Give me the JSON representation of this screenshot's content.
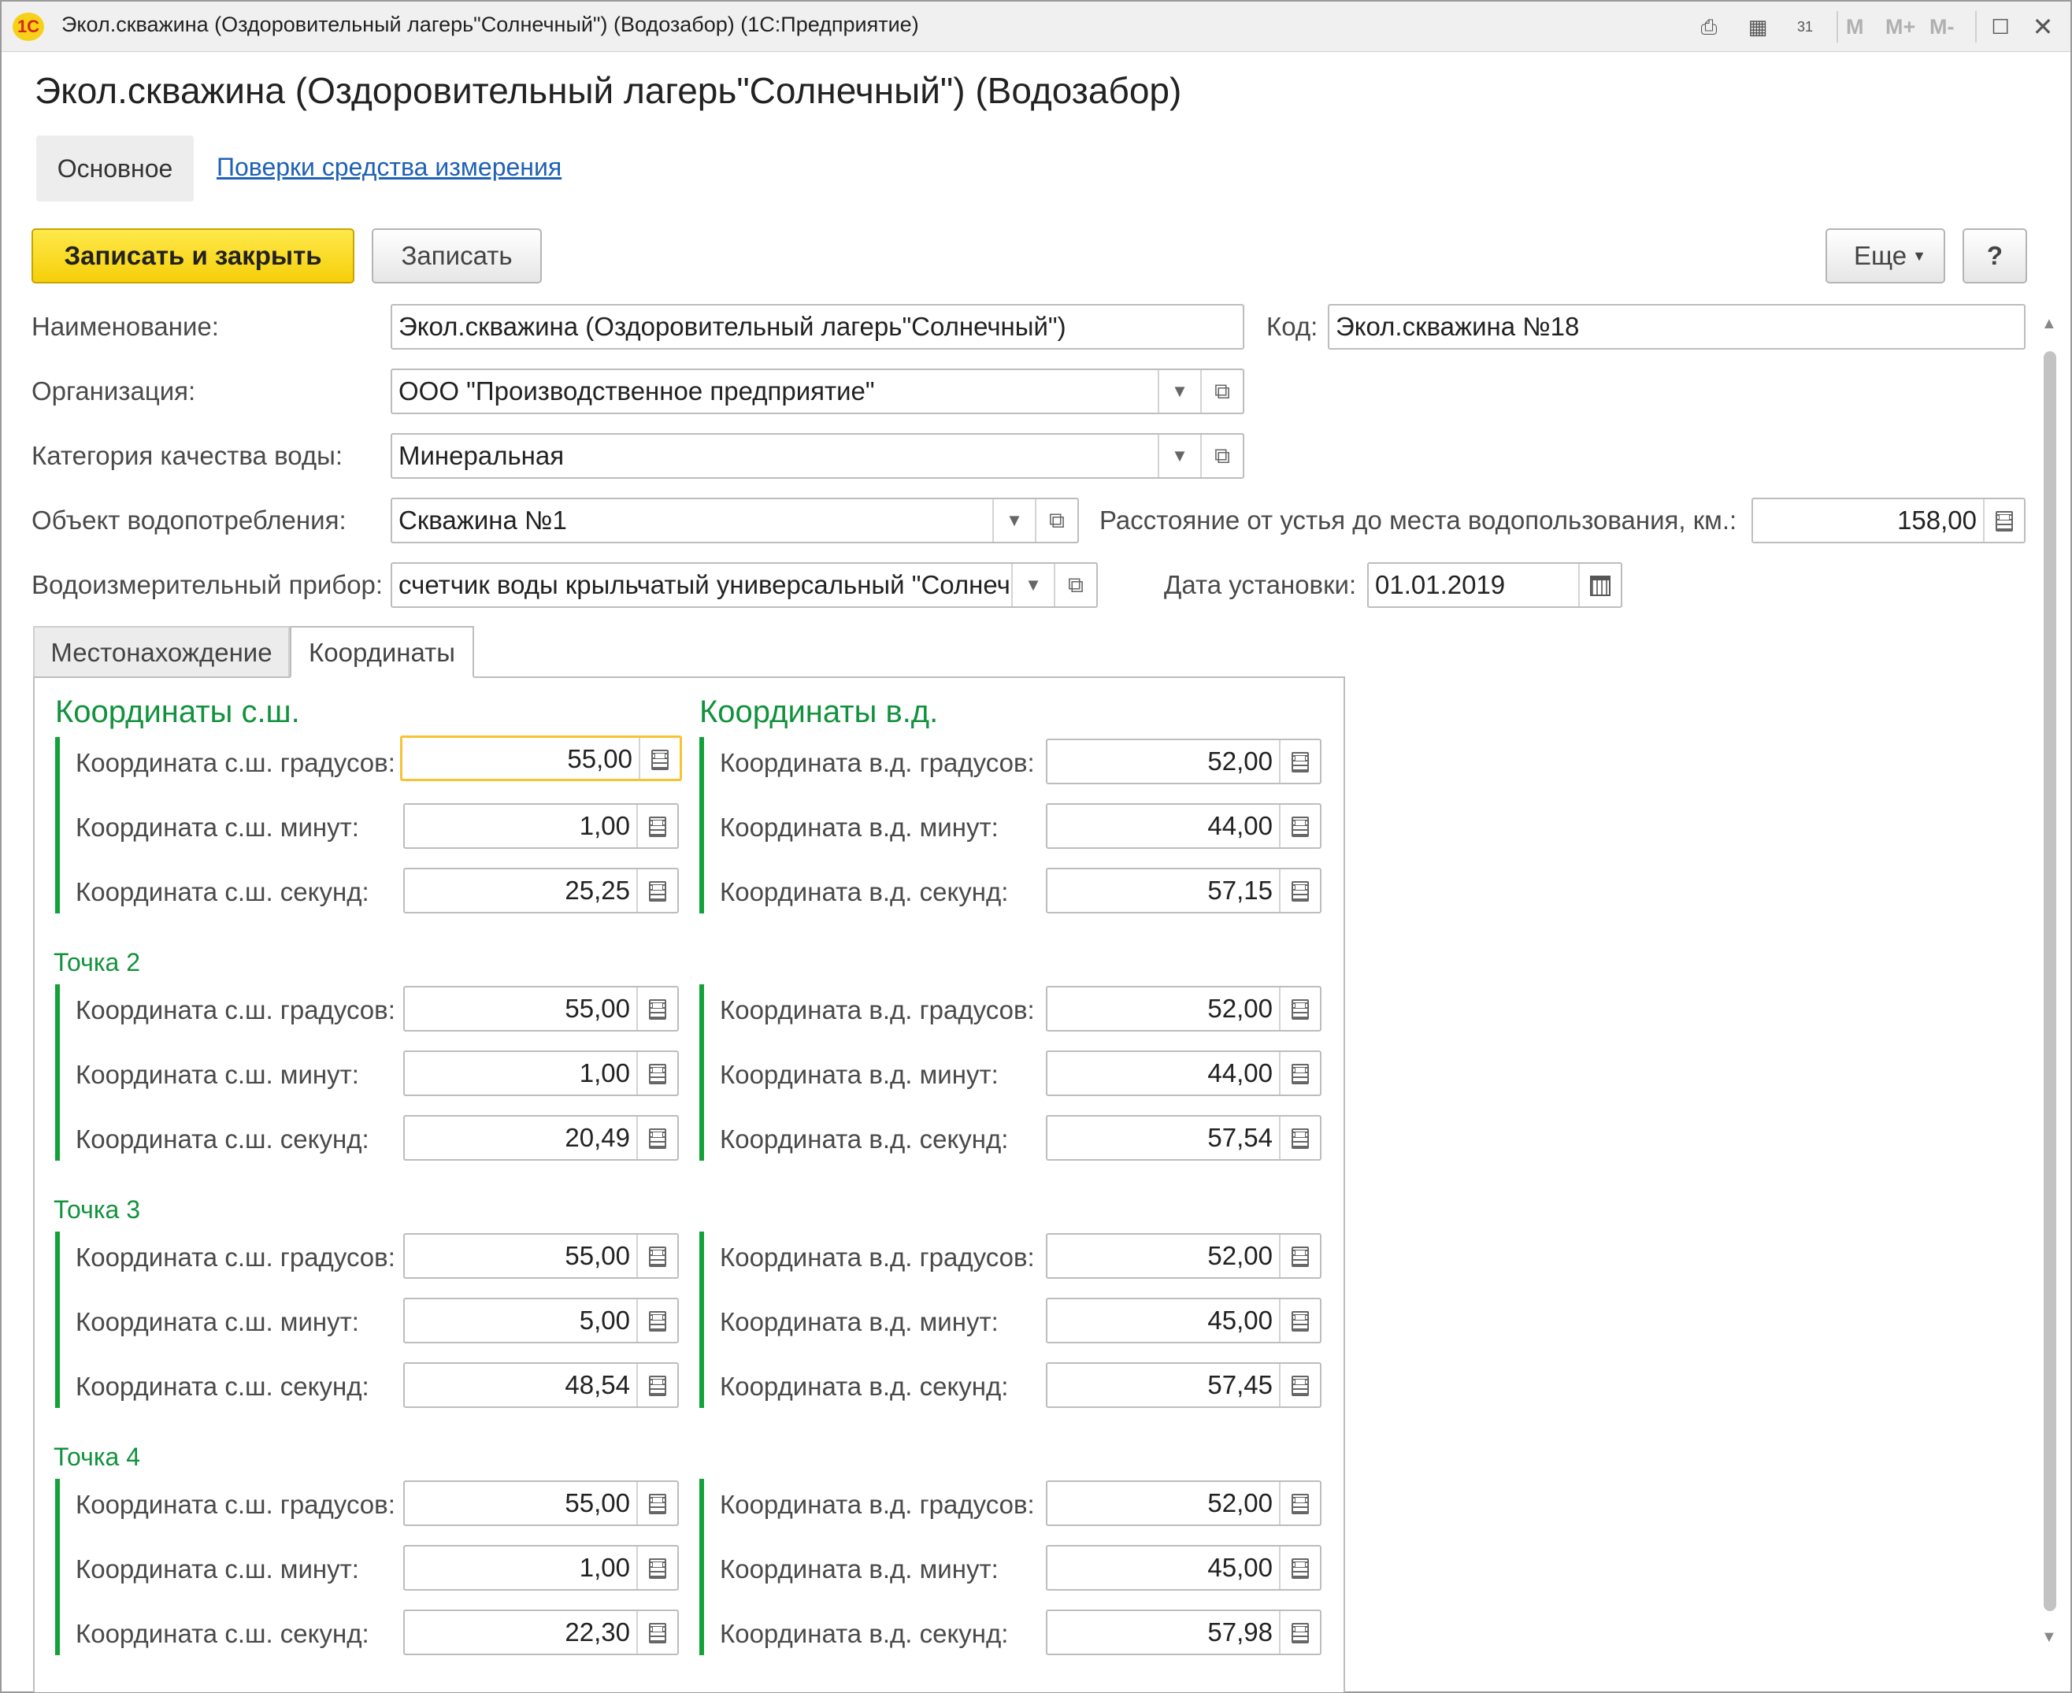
{
  "window": {
    "title": "Экол.скважина (Оздоровительный лагерь\"Солнечный\") (Водозабор)  (1С:Предприятие)",
    "logo_text": "1С",
    "m_buttons": [
      "M",
      "M+",
      "M-"
    ]
  },
  "page": {
    "heading": "Экол.скважина (Оздоровительный лагерь\"Солнечный\") (Водозабор)"
  },
  "nav": {
    "main_tab": "Основное",
    "link": "Поверки средства измерения"
  },
  "toolbar": {
    "save_close": "Записать и закрыть",
    "save": "Записать",
    "more": "Еще",
    "help": "?"
  },
  "form": {
    "name_label": "Наименование:",
    "name_value": "Экол.скважина (Оздоровительный лагерь\"Солнечный\")",
    "code_label": "Код:",
    "code_value": "Экол.скважина №18",
    "org_label": "Организация:",
    "org_value": "ООО \"Производственное предприятие\"",
    "quality_label": "Категория качества воды:",
    "quality_value": "Минеральная",
    "object_label": "Объект водопотребления:",
    "object_value": "Скважина №1",
    "distance_label": "Расстояние от устья до места водопользования, км.:",
    "distance_value": "158,00",
    "device_label": "Водоизмерительный прибор:",
    "device_value": "счетчик воды крыльчатый универсальный \"Солнечный\"",
    "install_label": "Дата установки:",
    "install_value": "01.01.2019"
  },
  "tabs": {
    "location": "Местонахождение",
    "coords": "Координаты"
  },
  "coords": {
    "lat_title": "Координаты с.ш.",
    "lon_title": "Координаты в.д.",
    "lat_deg": "Координата с.ш. градусов:",
    "lat_min": "Координата с.ш. минут:",
    "lat_sec": "Координата с.ш. секунд:",
    "lon_deg": "Координата в.д. градусов:",
    "lon_min": "Координата в.д. минут:",
    "lon_sec": "Координата в.д. секунд:",
    "points": [
      {
        "title": "",
        "lat": [
          "55,00",
          "1,00",
          "25,25"
        ],
        "lon": [
          "52,00",
          "44,00",
          "57,15"
        ]
      },
      {
        "title": "Точка 2",
        "lat": [
          "55,00",
          "1,00",
          "20,49"
        ],
        "lon": [
          "52,00",
          "44,00",
          "57,54"
        ]
      },
      {
        "title": "Точка 3",
        "lat": [
          "55,00",
          "5,00",
          "48,54"
        ],
        "lon": [
          "52,00",
          "45,00",
          "57,45"
        ]
      },
      {
        "title": "Точка 4",
        "lat": [
          "55,00",
          "1,00",
          "22,30"
        ],
        "lon": [
          "52,00",
          "45,00",
          "57,98"
        ]
      }
    ]
  },
  "colors": {
    "accent_green": "#12923d",
    "primary_button": "#f5cf0a",
    "link": "#1f61b5",
    "focus_border": "#f7c234"
  }
}
